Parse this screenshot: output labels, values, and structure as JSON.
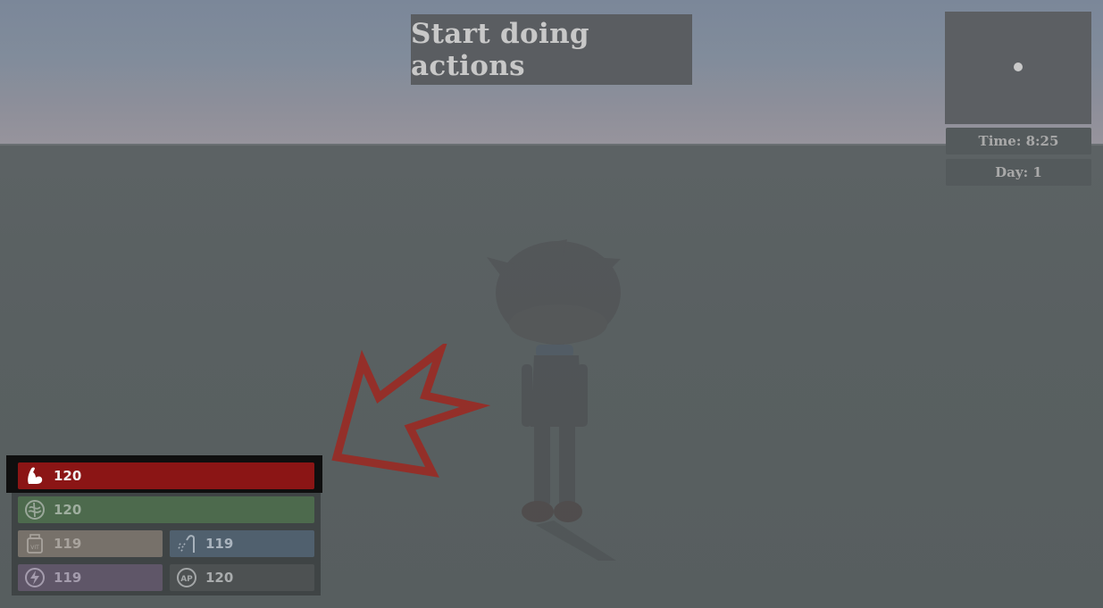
{
  "banner": {
    "text": "Start doing actions"
  },
  "hud": {
    "time": "Time: 8:25",
    "day": "Day: 1"
  },
  "stats": {
    "strength": {
      "value": "120",
      "icon": "flexed-arm-icon",
      "color": "#8b1515"
    },
    "brain": {
      "value": "120",
      "icon": "brain-icon",
      "color": "#4d6a4d"
    },
    "vitamins": {
      "value": "119",
      "icon": "vitamin-jar-icon",
      "color": "#77716a"
    },
    "hygiene": {
      "value": "119",
      "icon": "shower-icon",
      "color": "#50606e"
    },
    "energy": {
      "value": "119",
      "icon": "lightning-icon",
      "color": "#5f5668"
    },
    "action_points": {
      "value": "120",
      "icon": "ap-coin-icon",
      "color": "#4d5152"
    }
  },
  "colors": {
    "arrow": "#9a2a24",
    "banner_bg": "#5a5d61",
    "minimap_bg": "#5c5f63"
  }
}
